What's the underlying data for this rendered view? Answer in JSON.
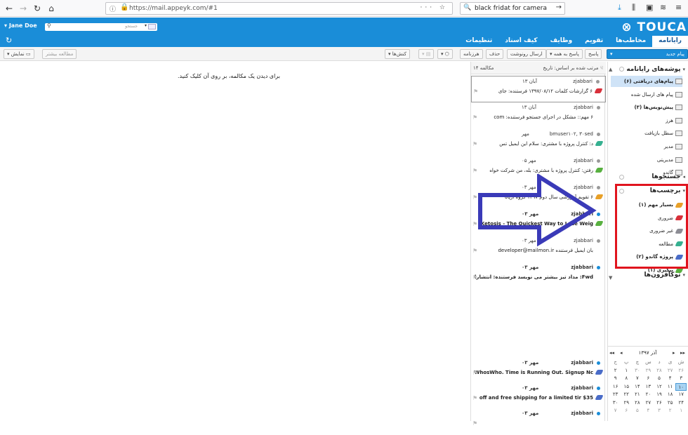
{
  "browser": {
    "url": "https://mail.appeyk.com/#1",
    "search": "black fridat for camera"
  },
  "header": {
    "user": "Jane Doe",
    "search_placeholder": "جستجو",
    "brand": "TOUCA",
    "tabs": [
      "رایانامه",
      "مخاطب‌ها",
      "تقویم",
      "وظایف",
      "کیف اسناد",
      "تنظیمات"
    ]
  },
  "toolbar": {
    "new_message": "پیام جدید",
    "reply": "پاسخ",
    "reply_all": "پاسخ به همه",
    "forward": "ارسال رونوشت",
    "delete": "حذف",
    "spam": "هرزنامه",
    "actions": "کنش‌ها",
    "read_more": "مطالعه بیشتر",
    "display": "نمایش"
  },
  "folders": {
    "mail_folders_title": "پوشه‌های رایانامه",
    "items": [
      {
        "label": "پیام‌های دریافتی (۶)",
        "bold": true,
        "selected": true
      },
      {
        "label": "پیام های ارسال شده",
        "bold": false,
        "selected": false
      },
      {
        "label": "پیش‌نویس‌ها (۳)",
        "bold": true,
        "selected": false
      },
      {
        "label": "هرز",
        "bold": false,
        "selected": false
      },
      {
        "label": "سطل بازیافت",
        "bold": false,
        "selected": false
      },
      {
        "label": "مدیر",
        "bold": false,
        "selected": false
      },
      {
        "label": "مدیریتی",
        "bold": false,
        "selected": false
      },
      {
        "label": "گاندو",
        "bold": false,
        "selected": false
      }
    ],
    "searches_title": "جستجوها",
    "tags_title": "برچسب‌ها",
    "tags": [
      {
        "label": "بسیار مهم (۱)",
        "color": "#e8a028",
        "bold": true
      },
      {
        "label": "ضروری",
        "color": "#d8303a",
        "bold": false
      },
      {
        "label": "غیر ضروری",
        "color": "#8c8c94",
        "bold": false
      },
      {
        "label": "مطالعه",
        "color": "#36b090",
        "bold": false
      },
      {
        "label": "پروژه گاندو (۲)",
        "color": "#4a6cc8",
        "bold": true
      },
      {
        "label": "پیگیری (۱)",
        "color": "#58b040",
        "bold": true
      }
    ],
    "addons_title": "توکافزون‌ها"
  },
  "calendar": {
    "title": "آذر ۱۳۹۷",
    "weekdays": [
      "ش",
      "ی",
      "د",
      "س",
      "چ",
      "پ",
      "ج"
    ],
    "weeks": [
      [
        "۲۶",
        "۲۷",
        "۲۸",
        "۲۹",
        "۳۰",
        "۱",
        "۲"
      ],
      [
        "۳",
        "۴",
        "۵",
        "۶",
        "۷",
        "۸",
        "۹"
      ],
      [
        "۱۰",
        "۱۱",
        "۱۲",
        "۱۳",
        "۱۴",
        "۱۵",
        "۱۶"
      ],
      [
        "۱۷",
        "۱۸",
        "۱۹",
        "۲۰",
        "۲۱",
        "۲۲",
        "۲۳"
      ],
      [
        "۲۴",
        "۲۵",
        "۲۶",
        "۲۷",
        "۲۸",
        "۲۹",
        "۳۰"
      ],
      [
        "۱",
        "۲",
        "۳",
        "۴",
        "۵",
        "۶",
        "۷"
      ]
    ],
    "today": "۱۰"
  },
  "list": {
    "sort": "مرتب شده بر اساس: تاریخ",
    "count": "۱۴ مکالمه",
    "messages": [
      {
        "sender": "zjabbari",
        "date": "۱۳ آبان",
        "subject": "۶ گزارشات کلمات ۱۳۹۷/۰۸/۱۲ فرستنده: جای",
        "tag": "#d8303a",
        "bold": false,
        "unread": false,
        "selected": true
      },
      {
        "sender": "zjabbari",
        "date": "۱۳ آبان",
        "subject": "۶ مهم:: مشکل در اجرای جستجو فرستنده: com",
        "tag": "",
        "bold": false,
        "unread": false,
        "selected": false
      },
      {
        "sender": "bmuser۱۰۲, ۳۰sed",
        "date": "مهر",
        "subject": "د: کنترل پروژه با مشتری: سلام این ایمیل تس",
        "tag": "#36b090",
        "bold": false,
        "unread": false,
        "selected": false
      },
      {
        "sender": "zjabbari",
        "date": "۰۵ مهر",
        "subject": "رفتن: کنترل پروژه با مشتری: بله، من شرکت خواه",
        "tag": "#58b040",
        "bold": false,
        "unread": false,
        "selected": false
      },
      {
        "sender": "zjabbari",
        "date": "۰۳ مهر",
        "subject": "۶ تقویم آموزشی سال دوم ۱۳۹۷ گروه آرپانا",
        "tag": "#e8a028",
        "bold": false,
        "unread": false,
        "selected": false
      },
      {
        "sender": "zjabbari",
        "date": "۰۳ مهر",
        "subject": "Ketosis - The Quickest Way to Lose Weig",
        "tag": "#58b040",
        "bold": true,
        "unread": true,
        "selected": false
      },
      {
        "sender": "zjabbari",
        "date": "۰۳ مهر",
        "subject": "بان ایمیل فرستنده developer@mailmon.ir",
        "tag": "",
        "bold": false,
        "unread": false,
        "selected": false
      },
      {
        "sender": "zjabbari",
        "date": "۰۳ مهر",
        "subject": "Fwd: مداد تیز بیشتر می نویسد فرستنده: انتشارات",
        "tag": "",
        "bold": true,
        "unread": true,
        "selected": false
      },
      {
        "sender": "zjabbari",
        "date": "۰۳ مهر",
        "subject": "WhosWho. Time is Running Out. Signup Nc",
        "tag": "#4a6cc8",
        "bold": true,
        "unread": true,
        "selected": false
      },
      {
        "sender": "zjabbari",
        "date": "۰۳ مهر",
        "subject": "$35 off and free shipping for a limited tir",
        "tag": "#4a6cc8",
        "bold": true,
        "unread": true,
        "selected": false
      },
      {
        "sender": "zjabbari",
        "date": "۰۳ مهر",
        "subject": "",
        "tag": "",
        "bold": true,
        "unread": true,
        "selected": false
      }
    ]
  },
  "reading": {
    "empty_message": "برای دیدن یک مکالمه، بر روی آن کلیک کنید."
  },
  "colors": {
    "header": "#1a8dd8",
    "highlight_box": "#e0141e",
    "arrow": "#3a3ab8"
  }
}
